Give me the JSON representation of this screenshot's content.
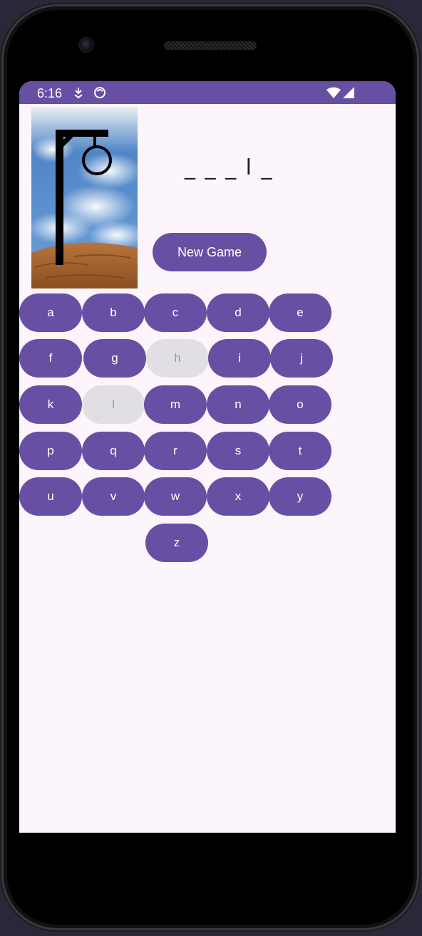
{
  "status_bar": {
    "time": "6:16",
    "icons": [
      "download-icon",
      "app-notification-icon",
      "wifi-icon",
      "signal-icon"
    ],
    "color": "#6750a4"
  },
  "game": {
    "word_display": "_ _ _ l _",
    "new_game_label": "New Game",
    "hangman_image": "gallows-empty-stage"
  },
  "keyboard": {
    "rows": [
      [
        {
          "label": "a",
          "used": false
        },
        {
          "label": "b",
          "used": false
        },
        {
          "label": "c",
          "used": false
        },
        {
          "label": "d",
          "used": false
        },
        {
          "label": "e",
          "used": false
        }
      ],
      [
        {
          "label": "f",
          "used": false
        },
        {
          "label": "g",
          "used": false
        },
        {
          "label": "h",
          "used": true
        },
        {
          "label": "i",
          "used": false
        },
        {
          "label": "j",
          "used": false
        }
      ],
      [
        {
          "label": "k",
          "used": false
        },
        {
          "label": "l",
          "used": true
        },
        {
          "label": "m",
          "used": false
        },
        {
          "label": "n",
          "used": false
        },
        {
          "label": "o",
          "used": false
        }
      ],
      [
        {
          "label": "p",
          "used": false
        },
        {
          "label": "q",
          "used": false
        },
        {
          "label": "r",
          "used": false
        },
        {
          "label": "s",
          "used": false
        },
        {
          "label": "t",
          "used": false
        }
      ],
      [
        {
          "label": "u",
          "used": false
        },
        {
          "label": "v",
          "used": false
        },
        {
          "label": "w",
          "used": false
        },
        {
          "label": "x",
          "used": false
        },
        {
          "label": "y",
          "used": false
        }
      ],
      [
        {
          "label": "z",
          "used": false
        }
      ]
    ]
  },
  "colors": {
    "accent": "#6750a4",
    "disabled": "#e2dfe4",
    "background": "#fdf5fc"
  }
}
